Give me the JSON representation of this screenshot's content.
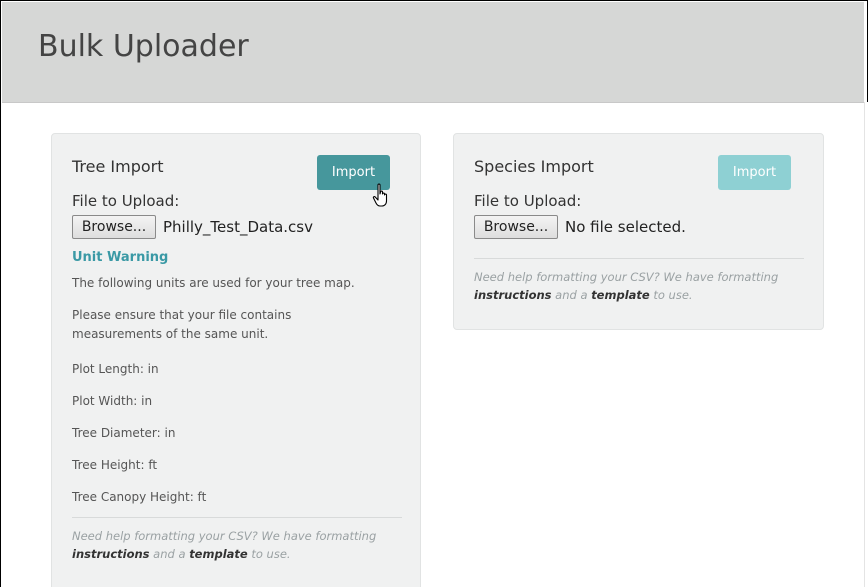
{
  "page": {
    "title": "Bulk Uploader"
  },
  "tree_import": {
    "title": "Tree Import",
    "import_label": "Import",
    "file_label": "File to Upload:",
    "browse_label": "Browse...",
    "file_name": "Philly_Test_Data.csv",
    "unit_warning": {
      "title": "Unit Warning",
      "line1": "The following units are used for your tree map.",
      "line2": "Please ensure that your file contains measurements of the same unit.",
      "units": [
        "Plot Length: in",
        "Plot Width: in",
        "Tree Diameter: in",
        "Tree Height: ft",
        "Tree Canopy Height: ft"
      ]
    },
    "help": {
      "prefix": "Need help formatting your CSV? We have formatting ",
      "instructions": "instructions",
      "middle": " and a ",
      "template": "template",
      "suffix": " to use."
    }
  },
  "species_import": {
    "title": "Species Import",
    "import_label": "Import",
    "file_label": "File to Upload:",
    "browse_label": "Browse...",
    "file_name": "No file selected.",
    "help": {
      "prefix": "Need help formatting your CSV? We have formatting ",
      "instructions": "instructions",
      "middle": " and a ",
      "template": "template",
      "suffix": " to use."
    }
  },
  "colors": {
    "header_bg": "#d6d7d6",
    "panel_bg": "#f0f1f1",
    "import_active": "#46979c",
    "import_disabled": "#8ed0d3",
    "warning_text": "#3a99a5"
  },
  "icons": {
    "cursor": "hand-pointer-icon"
  }
}
